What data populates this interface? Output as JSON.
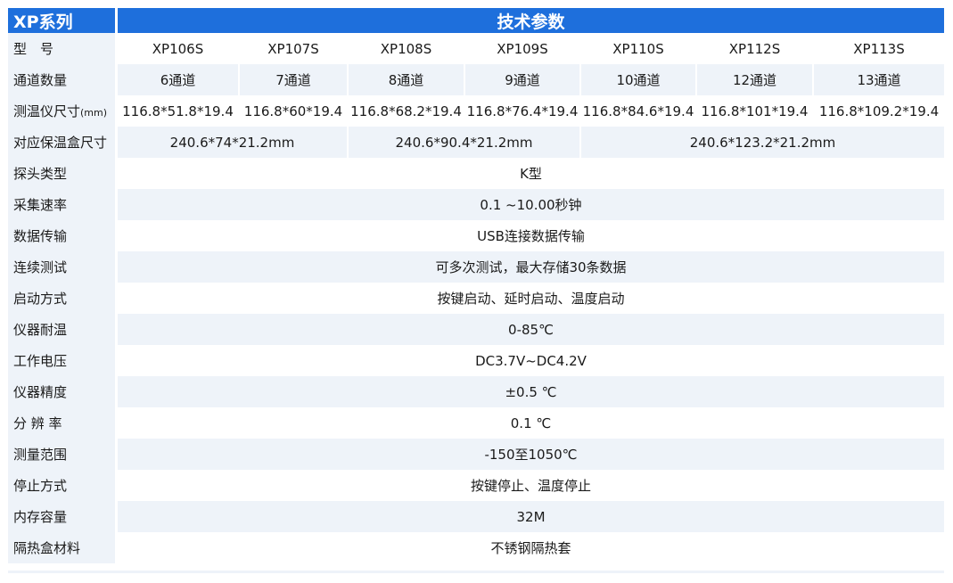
{
  "header": {
    "series": "XP系列",
    "title": "技术参数"
  },
  "models": {
    "label": "型　号",
    "values": [
      "XP106S",
      "XP107S",
      "XP108S",
      "XP109S",
      "XP110S",
      "XP112S",
      "XP113S"
    ]
  },
  "channels": {
    "label": "通道数量",
    "values": [
      "6通道",
      "7通道",
      "8通道",
      "9通道",
      "10通道",
      "12通道",
      "13通道"
    ]
  },
  "size": {
    "label": "测温仪尺寸",
    "unit": "(mm)",
    "values": [
      "116.8*51.8*19.4",
      "116.8*60*19.4",
      "116.8*68.2*19.4",
      "116.8*76.4*19.4",
      "116.8*84.6*19.4",
      "116.8*101*19.4",
      "116.8*109.2*19.4"
    ]
  },
  "box_size": {
    "label": "对应保温盒尺寸",
    "values": [
      "240.6*74*21.2mm",
      "240.6*90.4*21.2mm",
      "240.6*123.2*21.2mm"
    ]
  },
  "specs": [
    {
      "label": "探头类型",
      "value": "K型"
    },
    {
      "label": "采集速率",
      "value": "0.1 ~10.00秒钟"
    },
    {
      "label": "数据传输",
      "value": "USB连接数据传输"
    },
    {
      "label": "连续测试",
      "value": "可多次测试，最大存储30条数据"
    },
    {
      "label": "启动方式",
      "value": "按键启动、延时启动、温度启动"
    },
    {
      "label": "仪器耐温",
      "value": "0-85℃"
    },
    {
      "label": "工作电压",
      "value": "DC3.7V~DC4.2V"
    },
    {
      "label": "仪器精度",
      "value": "±0.5 ℃"
    },
    {
      "label": "分 辨 率",
      "value": "0.1  ℃"
    },
    {
      "label": "测量范围",
      "value": "-150至1050℃"
    },
    {
      "label": "停止方式",
      "value": "按键停止、温度停止"
    },
    {
      "label": "内存容量",
      "value": "32M"
    },
    {
      "label": "隔热盒材料",
      "value": "不锈钢隔热套"
    }
  ],
  "colors": {
    "header_bg": "#1e6fdc",
    "stripe": "#eef3f9"
  }
}
